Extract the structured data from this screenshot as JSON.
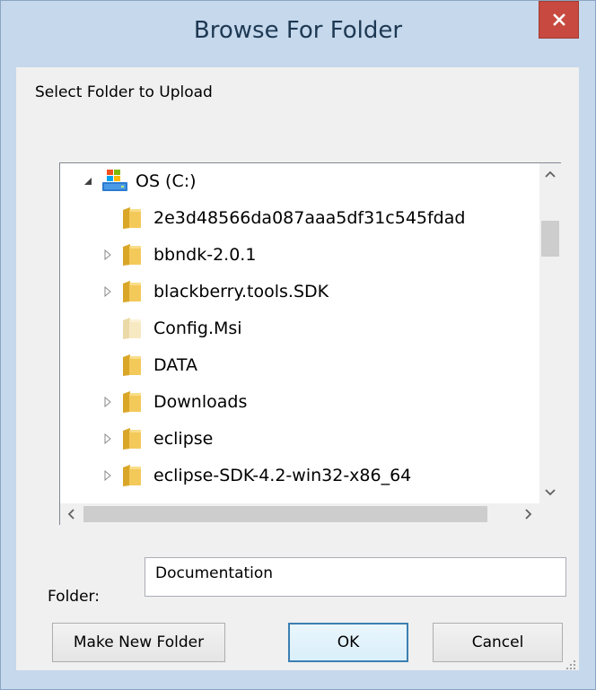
{
  "window": {
    "title": "Browse For Folder",
    "close_glyph": "✕",
    "accent_color": "#c7493f"
  },
  "dialog": {
    "prompt": "Select Folder to Upload"
  },
  "tree": {
    "root": {
      "label": "OS (C:)",
      "icon": "drive-icon",
      "expanded": true
    },
    "items": [
      {
        "label": "2e3d48566da087aaa5df31c545fdad",
        "has_children": false,
        "hidden": false
      },
      {
        "label": "bbndk-2.0.1",
        "has_children": true,
        "hidden": false
      },
      {
        "label": "blackberry.tools.SDK",
        "has_children": true,
        "hidden": false
      },
      {
        "label": "Config.Msi",
        "has_children": false,
        "hidden": true
      },
      {
        "label": "DATA",
        "has_children": false,
        "hidden": false
      },
      {
        "label": "Downloads",
        "has_children": true,
        "hidden": false
      },
      {
        "label": "eclipse",
        "has_children": true,
        "hidden": false
      },
      {
        "label": "eclipse-SDK-4.2-win32-x86_64",
        "has_children": true,
        "hidden": false
      }
    ]
  },
  "folder_field": {
    "label": "Folder:",
    "value": "Documentation"
  },
  "buttons": {
    "make_new_folder": "Make New Folder",
    "ok": "OK",
    "cancel": "Cancel"
  }
}
